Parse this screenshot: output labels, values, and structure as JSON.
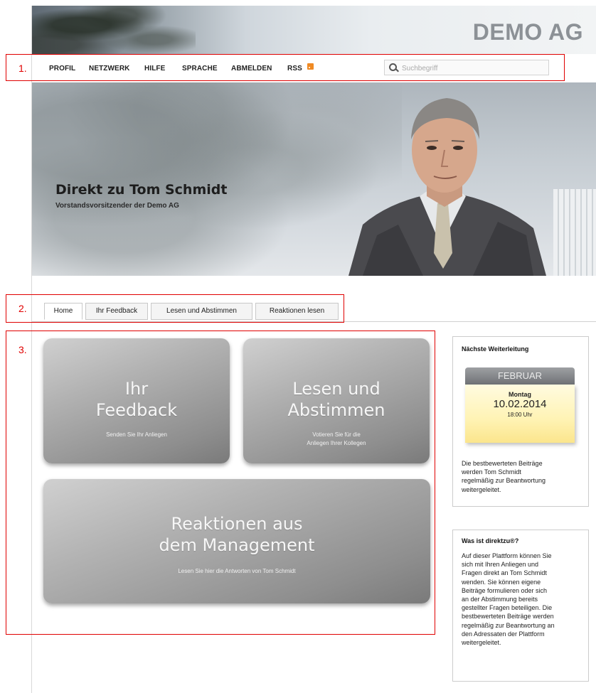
{
  "header": {
    "brand": "DEMO AG"
  },
  "nav": {
    "items": [
      "PROFIL",
      "NETZWERK",
      "HILFE",
      "SPRACHE",
      "ABMELDEN",
      "RSS"
    ],
    "search_placeholder": "Suchbegriff"
  },
  "hero": {
    "title": "Direkt zu Tom Schmidt",
    "subtitle": "Vorstandsvorsitzender der Demo AG"
  },
  "tabs": [
    "Home",
    "Ihr Feedback",
    "Lesen und Abstimmen",
    "Reaktionen lesen"
  ],
  "tiles": [
    {
      "title_line1": "Ihr",
      "title_line2": "Feedback",
      "sub_line1": "Senden Sie Ihr Anliegen",
      "sub_line2": ""
    },
    {
      "title_line1": "Lesen und",
      "title_line2": "Abstimmen",
      "sub_line1": "Votieren Sie für die",
      "sub_line2": "Anliegen Ihrer Kollegen"
    },
    {
      "title_line1": "Reaktionen aus",
      "title_line2": "dem Management",
      "sub_line1": "Lesen Sie hier die Antworten von Tom Schmidt",
      "sub_line2": ""
    }
  ],
  "sidebar": {
    "next_heading": "Nächste Weiterleitung",
    "calendar": {
      "month": "FEBRUAR",
      "weekday": "Montag",
      "date": "10.02.2014",
      "time": "18:00 Uhr"
    },
    "next_text": "Die bestbewerteten Beiträge\nwerden Tom Schmidt\nregelmäßig zur Beantwortung\nweitergeleitet.",
    "about_heading": "Was ist direktzu®?",
    "about_text": "Auf dieser Plattform können Sie\nsich mit Ihren Anliegen und\nFragen direkt an Tom Schmidt\nwenden. Sie können eigene\nBeiträge formulieren oder sich\nan der Abstimmung bereits\ngestellter Fragen beteiligen. Die\nbestbewerteten Beiträge werden\nregelmäßig zur Beantwortung an\nden Adressaten der Plattform\nweitergeleitet."
  },
  "annotations": [
    "1.",
    "2.",
    "3."
  ],
  "colors": {
    "annotation": "#e00000",
    "rss": "#f08a24",
    "calendar_note": "#fff3b4"
  }
}
